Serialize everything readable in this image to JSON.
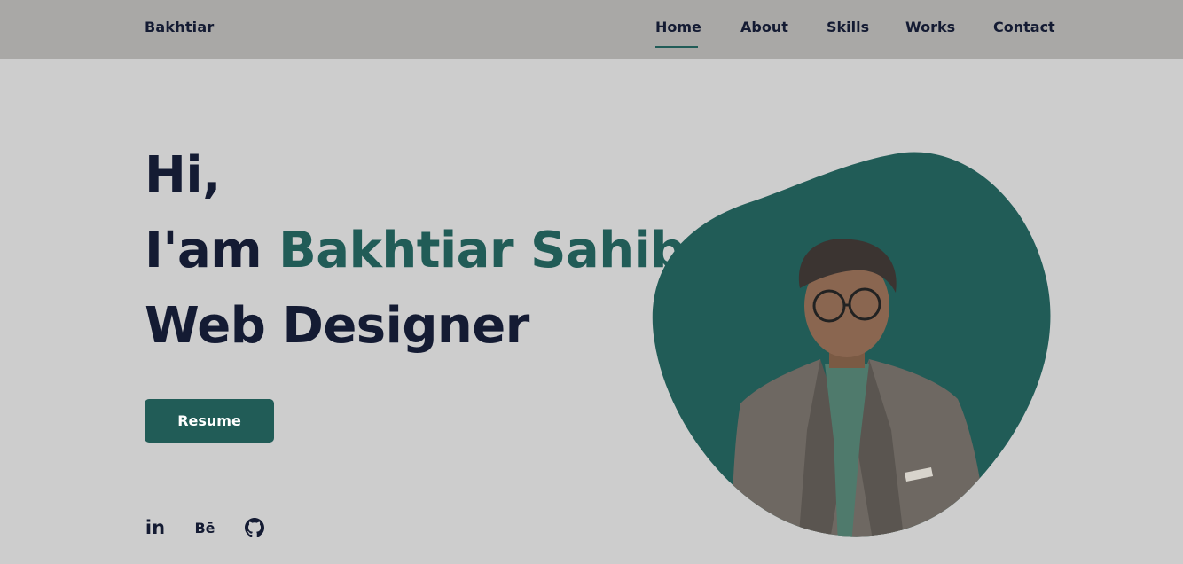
{
  "header": {
    "logo": "Bakhtiar",
    "nav": [
      {
        "label": "Home",
        "active": true
      },
      {
        "label": "About"
      },
      {
        "label": "Skills"
      },
      {
        "label": "Works"
      },
      {
        "label": "Contact"
      }
    ]
  },
  "hero": {
    "greeting": "Hi,",
    "intro_prefix": "I'am",
    "name": "Bakhtiar Sahib",
    "role": "Web Designer",
    "resume_label": "Resume"
  },
  "social": {
    "linkedin_glyph": "in",
    "behance_glyph": "Bē",
    "icons": [
      "linkedin-icon",
      "behance-icon",
      "github-icon"
    ]
  },
  "colors": {
    "accent": "#215c57",
    "text": "#141b33",
    "header_bg": "#a9a8a6",
    "page_bg": "#cdcdcd"
  }
}
